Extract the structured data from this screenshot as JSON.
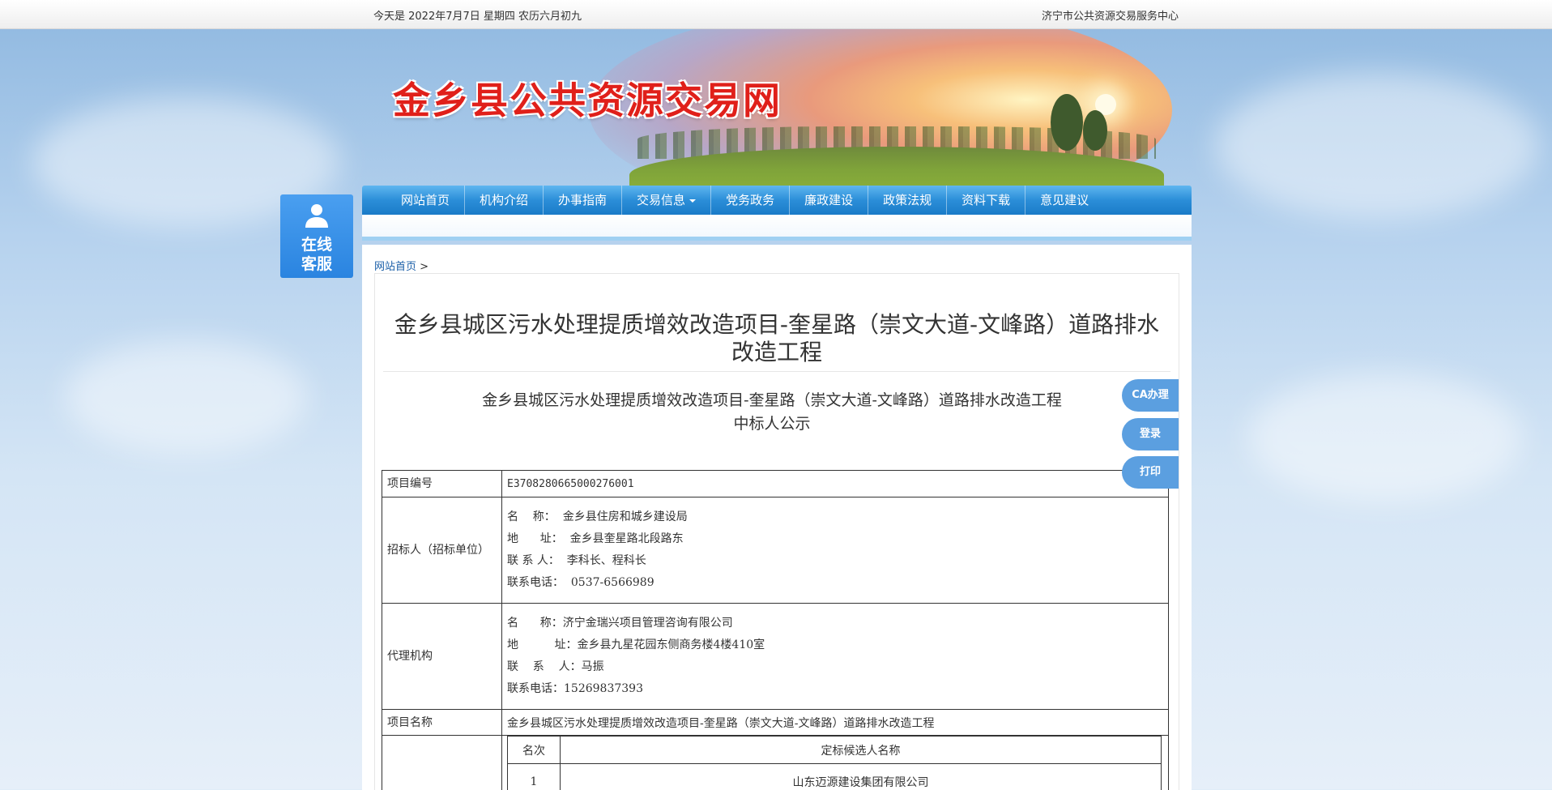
{
  "topbar": {
    "date": "今天是 2022年7月7日 星期四 农历六月初九",
    "center_name": "济宁市公共资源交易服务中心"
  },
  "banner": {
    "site_title": "金乡县公共资源交易网"
  },
  "nav": {
    "items": [
      "网站首页",
      "机构介绍",
      "办事指南",
      "交易信息",
      "党务政务",
      "廉政建设",
      "政策法规",
      "资料下载",
      "意见建议"
    ]
  },
  "service": {
    "line1": "在线",
    "line2": "客服"
  },
  "breadcrumb": {
    "home": "网站首页",
    "sep": ">"
  },
  "article": {
    "title": "金乡县城区污水处理提质增效改造项目-奎星路（崇文大道-文峰路）道路排水改造工程",
    "doc_title_line1": "金乡县城区污水处理提质增效改造项目-奎星路（崇文大道-文峰路）道路排水改造工程",
    "doc_title_line2": "中标人公示"
  },
  "table": {
    "project_no_label": "项目编号",
    "project_no": "E3708280665000276001",
    "tenderer_label": "招标人（招标单位）",
    "tenderer": {
      "name": "名    称：  金乡县住房和城乡建设局",
      "address": "地      址：  金乡县奎星路北段路东",
      "contact": "联 系 人：  李科长、程科长",
      "phone": "联系电话：  0537-6566989"
    },
    "agency_label": "代理机构",
    "agency": {
      "name": "名      称：济宁金瑞兴项目管理咨询有限公司",
      "address": "地          址：金乡县九星花园东侧商务楼4楼410室",
      "contact": "联    系    人：马振",
      "phone": "联系电话：15269837393"
    },
    "project_name_label": "项目名称",
    "project_name": "金乡县城区污水处理提质增效改造项目-奎星路（崇文大道-文峰路）道路排水改造工程",
    "candidates": {
      "col_rank": "名次",
      "col_name": "定标候选人名称",
      "rows": [
        {
          "rank": "1",
          "name": "山东迈源建设集团有限公司"
        }
      ]
    }
  },
  "side_buttons": {
    "ca": "CA办理",
    "login": "登录",
    "print": "打印"
  }
}
